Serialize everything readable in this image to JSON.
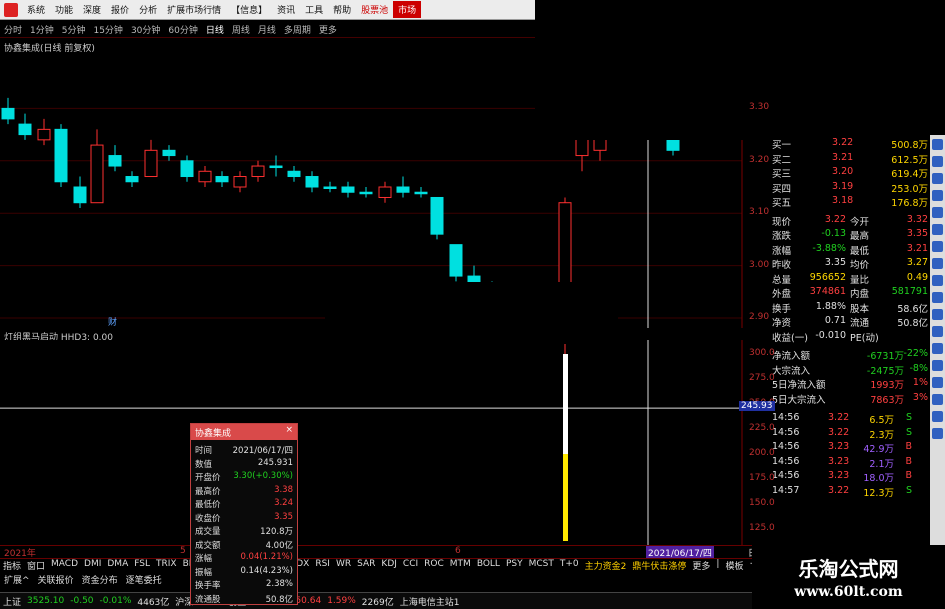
{
  "menubar": [
    "系统",
    "功能",
    "深度",
    "报价",
    "分析",
    "扩展市场行情",
    "【信息】",
    "资讯",
    "工具",
    "帮助",
    "股票池",
    "市场"
  ],
  "periods": [
    "分时",
    "1分钟",
    "5分钟",
    "15分钟",
    "30分钟",
    "60分钟",
    "日线",
    "周线",
    "月线",
    "多周期",
    "更多"
  ],
  "chart_title": "协鑫集成(日线 前复权)",
  "ind_title": "灯组黑马启动 HHD3: 0.00",
  "price_axis": [
    "3.30",
    "3.20",
    "3.10",
    "3.00",
    "2.90"
  ],
  "ind_axis": [
    "300.0",
    "275.0",
    "250.0",
    "225.0",
    "200.0",
    "175.0",
    "150.0",
    "125.0"
  ],
  "ind_cursor": "245.93",
  "date_labels": {
    "left": "2021年",
    "mid": "5",
    "mid2": "6",
    "cursor": "2021/06/17/四",
    "right": "日"
  },
  "order_book": [
    {
      "label": "买一",
      "price": "3.22",
      "vol": "500.8万"
    },
    {
      "label": "买二",
      "price": "3.21",
      "vol": "612.5万"
    },
    {
      "label": "买三",
      "price": "3.20",
      "vol": "619.4万"
    },
    {
      "label": "买四",
      "price": "3.19",
      "vol": "253.0万"
    },
    {
      "label": "买五",
      "price": "3.18",
      "vol": "176.8万"
    }
  ],
  "quote": [
    {
      "k1": "现价",
      "v1": "3.22",
      "k2": "今开",
      "v2": "3.32"
    },
    {
      "k1": "涨跌",
      "v1": "-0.13",
      "k2": "最高",
      "v2": "3.35"
    },
    {
      "k1": "涨幅",
      "v1": "-3.88%",
      "k2": "最低",
      "v2": "3.21"
    },
    {
      "k1": "昨收",
      "v1": "3.35",
      "k2": "均价",
      "v2": "3.27"
    },
    {
      "k1": "总量",
      "v1": "956652",
      "k2": "量比",
      "v2": "0.49"
    },
    {
      "k1": "外盘",
      "v1": "374861",
      "k2": "内盘",
      "v2": "581791"
    },
    {
      "k1": "换手",
      "v1": "1.88%",
      "k2": "股本",
      "v2": "58.6亿"
    },
    {
      "k1": "净资",
      "v1": "0.71",
      "k2": "流通",
      "v2": "50.8亿"
    },
    {
      "k1": "收益(一)",
      "v1": "-0.010",
      "k2": "PE(动)",
      "v2": ""
    }
  ],
  "flows": [
    {
      "k": "净流入额",
      "v": "-6731万",
      "p": "-22%"
    },
    {
      "k": "大宗流入",
      "v": "-2475万",
      "p": "-8%"
    },
    {
      "k": "5日净流入额",
      "v": "1993万",
      "p": "1%"
    },
    {
      "k": "5日大宗流入",
      "v": "7863万",
      "p": "3%"
    }
  ],
  "ticks": [
    {
      "t": "14:56",
      "p": "3.22",
      "v": "6.5万",
      "s": "S"
    },
    {
      "t": "14:56",
      "p": "3.22",
      "v": "2.3万",
      "s": "S"
    },
    {
      "t": "14:56",
      "p": "3.23",
      "v": "42.9万",
      "s": "B"
    },
    {
      "t": "14:56",
      "p": "3.23",
      "v": "2.1万",
      "s": "B"
    },
    {
      "t": "14:56",
      "p": "3.23",
      "v": "18.0万",
      "s": "B"
    },
    {
      "t": "14:57",
      "p": "3.22",
      "v": "12.3万",
      "s": "S"
    }
  ],
  "popup": {
    "title": "协鑫集成",
    "rows": [
      {
        "k": "时间",
        "v": "2021/06/17/四",
        "c": "w"
      },
      {
        "k": "数值",
        "v": "245.931",
        "c": "w"
      },
      {
        "k": "开盘价",
        "v": "3.30(+0.30%)",
        "c": "g"
      },
      {
        "k": "最高价",
        "v": "3.38",
        "c": "r"
      },
      {
        "k": "最低价",
        "v": "3.24",
        "c": "r"
      },
      {
        "k": "收盘价",
        "v": "3.35",
        "c": "r"
      },
      {
        "k": "成交量",
        "v": "120.8万",
        "c": "w"
      },
      {
        "k": "成交额",
        "v": "4.00亿",
        "c": "w"
      },
      {
        "k": "涨幅",
        "v": "0.04(1.21%)",
        "c": "r"
      },
      {
        "k": "振幅",
        "v": "0.14(4.23%)",
        "c": "w"
      },
      {
        "k": "换手率",
        "v": "2.38%",
        "c": "w"
      },
      {
        "k": "流通股",
        "v": "50.8亿",
        "c": "w"
      }
    ]
  },
  "indicator_tabs": [
    "指标",
    "窗口",
    "MACD",
    "DMI",
    "DMA",
    "FSL",
    "TRIX",
    "BRAR",
    "",
    "L-TDX",
    "RSI",
    "WR",
    "SAR",
    "KDJ",
    "CCI",
    "ROC",
    "MTM",
    "BOLL",
    "PSY",
    "MCST",
    "T+0",
    "主力资金2",
    "鼎牛伏击涤停",
    "更多",
    "|",
    "模板",
    "+"
  ],
  "func_tabs": [
    "扩展^",
    "关联报价",
    "资金分布",
    "逐笔委托"
  ],
  "status": [
    {
      "t": "上证",
      "c": "w"
    },
    {
      "t": "3525.10",
      "c": "g"
    },
    {
      "t": "-0.50",
      "c": "g"
    },
    {
      "t": "-0.01%",
      "c": "g"
    },
    {
      "t": "4463亿",
      "c": "w"
    },
    {
      "t": "沪深",
      "c": "w"
    },
    {
      "t": "5102",
      "c": "y"
    },
    {
      "t": "创业",
      "c": "w"
    },
    {
      "t": "3239.23",
      "c": "r"
    },
    {
      "t": "50.64",
      "c": "r"
    },
    {
      "t": "1.59%",
      "c": "r"
    },
    {
      "t": "2269亿",
      "c": "w"
    },
    {
      "t": "上海电信主站1",
      "c": "w"
    }
  ],
  "marker": "财",
  "watermark": {
    "t1": "乐淘公式网",
    "t2": "www.60lt.com"
  },
  "colors": {
    "up": "#ff3030",
    "down": "#00e0e0",
    "bar": "#ffe800"
  },
  "chart_data": {
    "type": "candlestick",
    "candles": [
      {
        "o": 3.3,
        "c": 3.28,
        "h": 3.32,
        "l": 3.27
      },
      {
        "o": 3.27,
        "c": 3.25,
        "h": 3.29,
        "l": 3.24
      },
      {
        "o": 3.24,
        "c": 3.26,
        "h": 3.28,
        "l": 3.23
      },
      {
        "o": 3.26,
        "c": 3.16,
        "h": 3.27,
        "l": 3.15
      },
      {
        "o": 3.15,
        "c": 3.12,
        "h": 3.17,
        "l": 3.11
      },
      {
        "o": 3.12,
        "c": 3.23,
        "h": 3.26,
        "l": 3.12
      },
      {
        "o": 3.21,
        "c": 3.19,
        "h": 3.23,
        "l": 3.18
      },
      {
        "o": 3.17,
        "c": 3.16,
        "h": 3.18,
        "l": 3.15
      },
      {
        "o": 3.17,
        "c": 3.22,
        "h": 3.24,
        "l": 3.17
      },
      {
        "o": 3.22,
        "c": 3.21,
        "h": 3.23,
        "l": 3.2
      },
      {
        "o": 3.2,
        "c": 3.17,
        "h": 3.21,
        "l": 3.16
      },
      {
        "o": 3.16,
        "c": 3.18,
        "h": 3.19,
        "l": 3.15
      },
      {
        "o": 3.17,
        "c": 3.16,
        "h": 3.18,
        "l": 3.15
      },
      {
        "o": 3.15,
        "c": 3.17,
        "h": 3.18,
        "l": 3.14
      },
      {
        "o": 3.17,
        "c": 3.19,
        "h": 3.2,
        "l": 3.16
      },
      {
        "o": 3.19,
        "c": 3.19,
        "h": 3.21,
        "l": 3.17
      },
      {
        "o": 3.18,
        "c": 3.17,
        "h": 3.19,
        "l": 3.16
      },
      {
        "o": 3.17,
        "c": 3.15,
        "h": 3.18,
        "l": 3.14
      },
      {
        "o": 3.15,
        "c": 3.15,
        "h": 3.16,
        "l": 3.14
      },
      {
        "o": 3.15,
        "c": 3.14,
        "h": 3.16,
        "l": 3.13
      },
      {
        "o": 3.14,
        "c": 3.14,
        "h": 3.15,
        "l": 3.13
      },
      {
        "o": 3.13,
        "c": 3.15,
        "h": 3.16,
        "l": 3.12
      },
      {
        "o": 3.15,
        "c": 3.14,
        "h": 3.17,
        "l": 3.13
      },
      {
        "o": 3.14,
        "c": 3.14,
        "h": 3.15,
        "l": 3.13
      },
      {
        "o": 3.13,
        "c": 3.06,
        "h": 3.13,
        "l": 3.05
      },
      {
        "o": 3.04,
        "c": 2.98,
        "h": 3.04,
        "l": 2.97
      },
      {
        "o": 2.98,
        "c": 2.96,
        "h": 3.0,
        "l": 2.95
      },
      {
        "o": 2.96,
        "c": 2.95,
        "h": 2.97,
        "l": 2.94
      },
      {
        "o": 2.96,
        "c": 3.12,
        "h": 3.13,
        "l": 2.96
      },
      {
        "o": 3.21,
        "c": 3.28,
        "h": 3.32,
        "l": 3.18
      },
      {
        "o": 3.22,
        "c": 3.3,
        "h": 3.4,
        "l": 3.2
      },
      {
        "o": 3.35,
        "c": 3.33,
        "h": 3.38,
        "l": 3.31
      },
      {
        "o": 3.32,
        "c": 3.3,
        "h": 3.34,
        "l": 3.28
      },
      {
        "o": 3.3,
        "c": 3.35,
        "h": 3.38,
        "l": 3.24
      },
      {
        "o": 3.32,
        "c": 3.22,
        "h": 3.35,
        "l": 3.21
      }
    ],
    "ind_values": [
      {
        "idx": 31,
        "v": 300,
        "v2": 200
      }
    ],
    "ylim": [
      2.9,
      3.4
    ]
  }
}
